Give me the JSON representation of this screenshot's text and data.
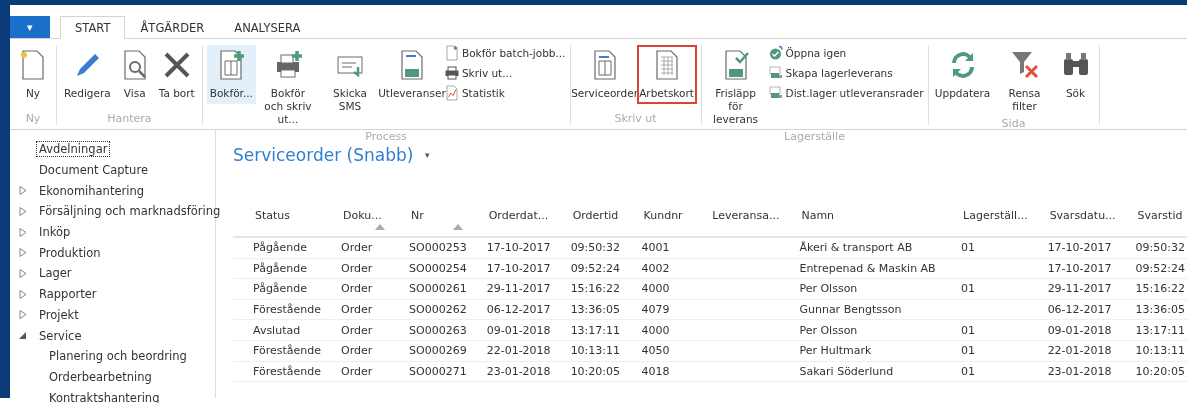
{
  "ribbon": {
    "menu_button": "▾",
    "tabs": [
      {
        "label": "START",
        "selected": true
      },
      {
        "label": "ÅTGÄRDER",
        "selected": false
      },
      {
        "label": "ANALYSERA",
        "selected": false
      }
    ],
    "groups": [
      {
        "label": "Ny",
        "actions": [
          {
            "kind": "large",
            "label": "Ny",
            "selected": false,
            "highlighted": false
          }
        ]
      },
      {
        "label": "Hantera",
        "actions": [
          {
            "kind": "large",
            "label": "Redigera",
            "selected": false,
            "highlighted": false
          },
          {
            "kind": "large",
            "label": "Visa",
            "selected": false,
            "highlighted": false
          },
          {
            "kind": "large",
            "label": "Ta bort",
            "selected": false,
            "highlighted": false
          }
        ]
      },
      {
        "label": "Process",
        "actions": [
          {
            "kind": "large",
            "label": "Bokför...",
            "selected": true,
            "highlighted": false
          },
          {
            "kind": "large",
            "label": "Bokför och skriv ut...",
            "selected": false,
            "highlighted": false
          },
          {
            "kind": "large",
            "label": "Skicka SMS",
            "selected": false,
            "highlighted": false
          },
          {
            "kind": "large",
            "label": "Utleveranser",
            "selected": false,
            "highlighted": false
          },
          {
            "kind": "small",
            "label": "Bokför batch-jobb...",
            "selected": false,
            "highlighted": false
          },
          {
            "kind": "small",
            "label": "Skriv ut...",
            "selected": false,
            "highlighted": false
          },
          {
            "kind": "small",
            "label": "Statistik",
            "selected": false,
            "highlighted": false
          }
        ]
      },
      {
        "label": "Skriv ut",
        "actions": [
          {
            "kind": "large",
            "label": "Serviceorder",
            "selected": false,
            "highlighted": false
          },
          {
            "kind": "large",
            "label": "Arbetskort",
            "selected": false,
            "highlighted": true
          }
        ]
      },
      {
        "label": "Lagerställe",
        "actions": [
          {
            "kind": "large",
            "label": "Frisläpp för leverans",
            "selected": false,
            "highlighted": false
          },
          {
            "kind": "small",
            "label": "Öppna igen",
            "selected": false,
            "highlighted": false
          },
          {
            "kind": "small",
            "label": "Skapa lagerleverans",
            "selected": false,
            "highlighted": false
          },
          {
            "kind": "small",
            "label": "Dist.lager utleveransrader",
            "selected": false,
            "highlighted": false
          }
        ]
      },
      {
        "label": "Sida",
        "actions": [
          {
            "kind": "large",
            "label": "Uppdatera",
            "selected": false,
            "highlighted": false
          },
          {
            "kind": "large",
            "label": "Rensa filter",
            "selected": false,
            "highlighted": false
          },
          {
            "kind": "large",
            "label": "Sök",
            "selected": false,
            "highlighted": false
          }
        ]
      }
    ]
  },
  "sidebar": {
    "items": [
      {
        "label": "Avdelningar",
        "focused": true
      },
      {
        "label": "Document Capture",
        "focused": false
      },
      {
        "label": "Ekonomihantering",
        "focused": false,
        "expanded": false
      },
      {
        "label": "Försäljning och marknadsföring",
        "focused": false,
        "expanded": false
      },
      {
        "label": "Inköp",
        "focused": false,
        "expanded": false
      },
      {
        "label": "Produktion",
        "focused": false,
        "expanded": false
      },
      {
        "label": "Lager",
        "focused": false,
        "expanded": false
      },
      {
        "label": "Rapporter",
        "focused": false,
        "expanded": false
      },
      {
        "label": "Projekt",
        "focused": false,
        "expanded": false
      },
      {
        "label": "Service",
        "focused": false,
        "expanded": true,
        "children": [
          {
            "label": "Planering och beordring",
            "focused": false
          },
          {
            "label": "Orderbearbetning",
            "focused": false
          },
          {
            "label": "Kontraktshantering",
            "focused": false
          }
        ]
      }
    ]
  },
  "page": {
    "title": "Serviceorder (Snabb)",
    "title_menu": "▾"
  },
  "table": {
    "columns": [
      {
        "label": "Status",
        "sorted": false
      },
      {
        "label": "Doku...",
        "sorted": true
      },
      {
        "label": "Nr",
        "sorted": true
      },
      {
        "label": "Orderdat...",
        "sorted": false
      },
      {
        "label": "Ordertid",
        "sorted": false
      },
      {
        "label": "Kundnr",
        "sorted": false
      },
      {
        "label": "Leveransa...",
        "sorted": false
      },
      {
        "label": "Namn",
        "sorted": false
      },
      {
        "label": "Lagerställ...",
        "sorted": false
      },
      {
        "label": "Svarsdatu...",
        "sorted": false
      },
      {
        "label": "Svarstid",
        "sorted": false
      }
    ],
    "rows": [
      [
        "Pågående",
        "Order",
        "SO000253",
        "17-10-2017",
        "09:50:32",
        "4001",
        "",
        "Åkeri & transport AB",
        "01",
        "17-10-2017",
        "09:50:32"
      ],
      [
        "Pågående",
        "Order",
        "SO000254",
        "17-10-2017",
        "09:52:24",
        "4002",
        "",
        "Entrepenad & Maskin AB",
        "",
        "17-10-2017",
        "09:52:24"
      ],
      [
        "Pågående",
        "Order",
        "SO000261",
        "29-11-2017",
        "15:16:22",
        "4000",
        "",
        "Per Olsson",
        "01",
        "29-11-2017",
        "15:16:22"
      ],
      [
        "Förestående",
        "Order",
        "SO000262",
        "06-12-2017",
        "13:36:05",
        "4079",
        "",
        "Gunnar Bengtsson",
        "",
        "06-12-2017",
        "13:36:05"
      ],
      [
        "Avslutad",
        "Order",
        "SO000263",
        "09-01-2018",
        "13:17:11",
        "4000",
        "",
        "Per Olsson",
        "01",
        "09-01-2018",
        "13:17:11"
      ],
      [
        "Förestående",
        "Order",
        "SO000269",
        "22-01-2018",
        "10:13:11",
        "4050",
        "",
        "Per Hultmark",
        "01",
        "22-01-2018",
        "10:13:11"
      ],
      [
        "Förestående",
        "Order",
        "SO000271",
        "23-01-2018",
        "10:20:05",
        "4018",
        "",
        "Sakari Söderlund",
        "01",
        "23-01-2018",
        "10:20:05"
      ]
    ]
  }
}
